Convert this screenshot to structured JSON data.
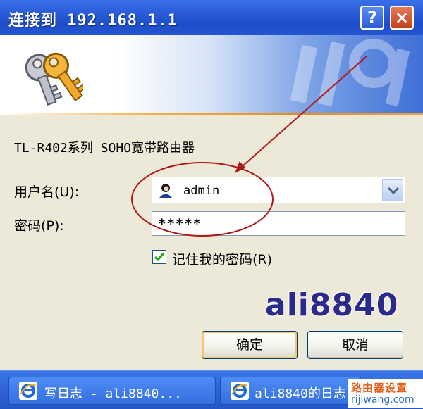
{
  "window": {
    "title": "连接到 192.168.1.1",
    "help_glyph": "?",
    "close_glyph": "×"
  },
  "dialog": {
    "device_label": "TL-R402系列 SOHO宽带路由器",
    "username_label": "用户名(U):",
    "username_value": "admin",
    "password_label": "密码(P):",
    "password_value": "*****",
    "remember_label": "记住我的密码(R)",
    "remember_checked": true,
    "ok_label": "确定",
    "cancel_label": "取消"
  },
  "watermark": "ali8840",
  "taskbar": {
    "items": [
      {
        "label": "写日志 - ali8840..."
      },
      {
        "label": "ali8840的日志"
      }
    ]
  },
  "site": {
    "name": "路由器设置",
    "url": "rijiwang.com"
  },
  "colors": {
    "title_bar": "#2A5BD8",
    "annotation": "#B01818",
    "watermark": "#2A2A8A"
  },
  "icons": [
    "keys-icon",
    "help-icon",
    "close-icon",
    "user-avatar-icon",
    "dropdown-arrow-icon",
    "checkmark-icon",
    "ie-icon"
  ]
}
